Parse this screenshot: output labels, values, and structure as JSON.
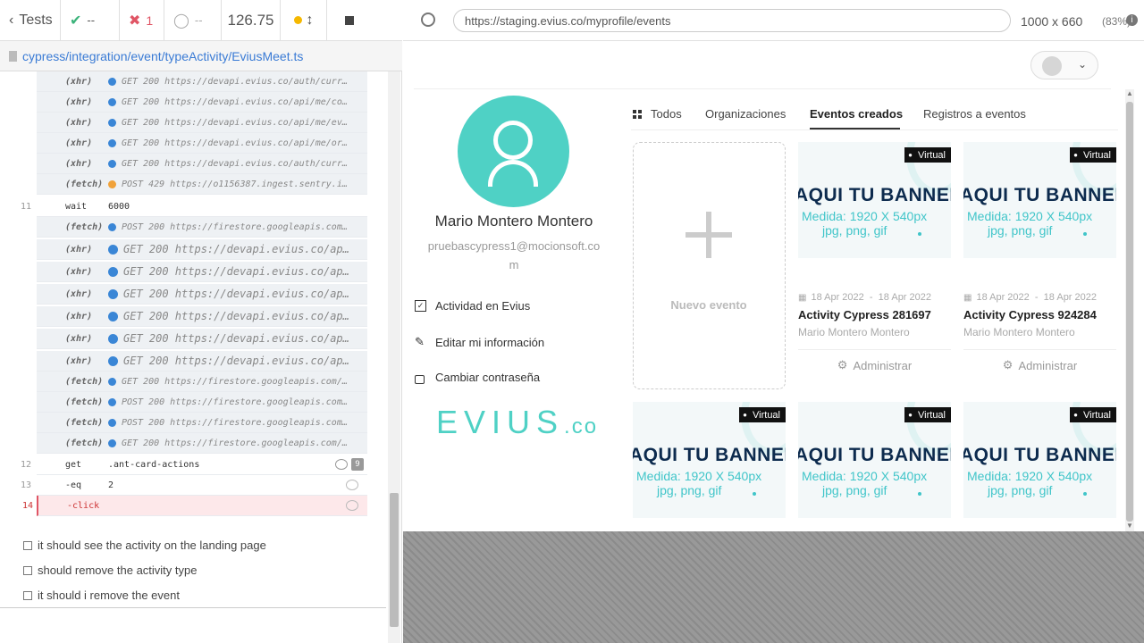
{
  "runner": {
    "tests_label": "Tests",
    "passed": "--",
    "failed": "1",
    "pending": "--",
    "duration": "126.75",
    "spec_path": "cypress/integration/event/typeActivity/EviusMeet.ts",
    "commands": [
      {
        "num": "",
        "name": "(xhr)",
        "msg": "GET 200 https://devapi.evius.co/auth/curr…",
        "dot": "blue",
        "size": "small"
      },
      {
        "num": "",
        "name": "(xhr)",
        "msg": "GET 200 https://devapi.evius.co/api/me/co…",
        "dot": "blue",
        "size": "small"
      },
      {
        "num": "",
        "name": "(xhr)",
        "msg": "GET 200 https://devapi.evius.co/api/me/ev…",
        "dot": "blue",
        "size": "small"
      },
      {
        "num": "",
        "name": "(xhr)",
        "msg": "GET 200 https://devapi.evius.co/api/me/or…",
        "dot": "blue",
        "size": "small"
      },
      {
        "num": "",
        "name": "(xhr)",
        "msg": "GET 200 https://devapi.evius.co/auth/curr…",
        "dot": "blue",
        "size": "small"
      },
      {
        "num": "",
        "name": "(fetch)",
        "msg": "POST 429 https://o1156387.ingest.sentry.i…",
        "dot": "orange",
        "size": "small"
      },
      {
        "num": "11",
        "name": "wait",
        "msg": "6000",
        "dot": "",
        "size": "plain"
      },
      {
        "num": "",
        "name": "(fetch)",
        "msg": "POST 200 https://firestore.googleapis.com…",
        "dot": "blue",
        "size": "small"
      },
      {
        "num": "",
        "name": "(xhr)",
        "msg": "GET 200 https://devapi.evius.co/ap…",
        "dot": "blue",
        "size": "big"
      },
      {
        "num": "",
        "name": "(xhr)",
        "msg": "GET 200 https://devapi.evius.co/ap…",
        "dot": "blue",
        "size": "big"
      },
      {
        "num": "",
        "name": "(xhr)",
        "msg": "GET 200 https://devapi.evius.co/ap…",
        "dot": "blue",
        "size": "big"
      },
      {
        "num": "",
        "name": "(xhr)",
        "msg": "GET 200 https://devapi.evius.co/ap…",
        "dot": "blue",
        "size": "big"
      },
      {
        "num": "",
        "name": "(xhr)",
        "msg": "GET 200 https://devapi.evius.co/ap…",
        "dot": "blue",
        "size": "big"
      },
      {
        "num": "",
        "name": "(xhr)",
        "msg": "GET 200 https://devapi.evius.co/ap…",
        "dot": "blue",
        "size": "big"
      },
      {
        "num": "",
        "name": "(fetch)",
        "msg": "GET 200 https://firestore.googleapis.com/…",
        "dot": "blue",
        "size": "small"
      },
      {
        "num": "",
        "name": "(fetch)",
        "msg": "POST 200 https://firestore.googleapis.com…",
        "dot": "blue",
        "size": "small"
      },
      {
        "num": "",
        "name": "(fetch)",
        "msg": "POST 200 https://firestore.googleapis.com…",
        "dot": "blue",
        "size": "small"
      },
      {
        "num": "",
        "name": "(fetch)",
        "msg": "GET 200 https://firestore.googleapis.com/…",
        "dot": "blue",
        "size": "small"
      },
      {
        "num": "12",
        "name": "get",
        "msg": ".ant-card-actions",
        "dot": "",
        "size": "plain",
        "badge": "9"
      },
      {
        "num": "13",
        "name": "-eq",
        "msg": "2",
        "dot": "",
        "size": "plain"
      },
      {
        "num": "14",
        "name": "-click",
        "msg": "",
        "dot": "",
        "size": "fail"
      }
    ],
    "tests": [
      "it should see the activity on the landing page",
      "should remove the activity type",
      "it should i remove the event"
    ]
  },
  "browser": {
    "url": "https://staging.evius.co/myprofile/events",
    "viewport_size": "1000 x 660",
    "zoom": "(83%)"
  },
  "profile": {
    "name": "Mario Montero Montero",
    "email_line1": "pruebascypress1@mocionsoft.co",
    "email_line2": "m",
    "menu": [
      "Actividad en Evius",
      "Editar mi información",
      "Cambiar contraseña"
    ],
    "logo_main": "EVIUS",
    "logo_suffix": ".co"
  },
  "tabs": [
    "Todos",
    "Organizaciones",
    "Eventos creados",
    "Registros a eventos"
  ],
  "active_tab": "Eventos creados",
  "new_event_label": "Nuevo evento",
  "events": [
    {
      "tag": "Virtual",
      "dates": "18 Apr 2022  -  18 Apr 2022",
      "title": "Activity Cypress 281697",
      "owner": "Mario Montero Montero",
      "action": "Administrar"
    },
    {
      "tag": "Virtual",
      "dates": "18 Apr 2022  -  18 Apr 2022",
      "title": "Activity Cypress 924284",
      "owner": "Mario Montero Montero",
      "action": "Administrar"
    }
  ],
  "banner": {
    "title": "AQUI TU BANNER",
    "sub1": "Medida: 1920 X 540px",
    "sub2": "jpg, png, gif"
  },
  "lower_tags": [
    "Virtual",
    "Virtual",
    "Virtual"
  ],
  "colors": {
    "accent": "#4fd1c5",
    "fail": "#e05565",
    "link": "#3a7bd5"
  }
}
